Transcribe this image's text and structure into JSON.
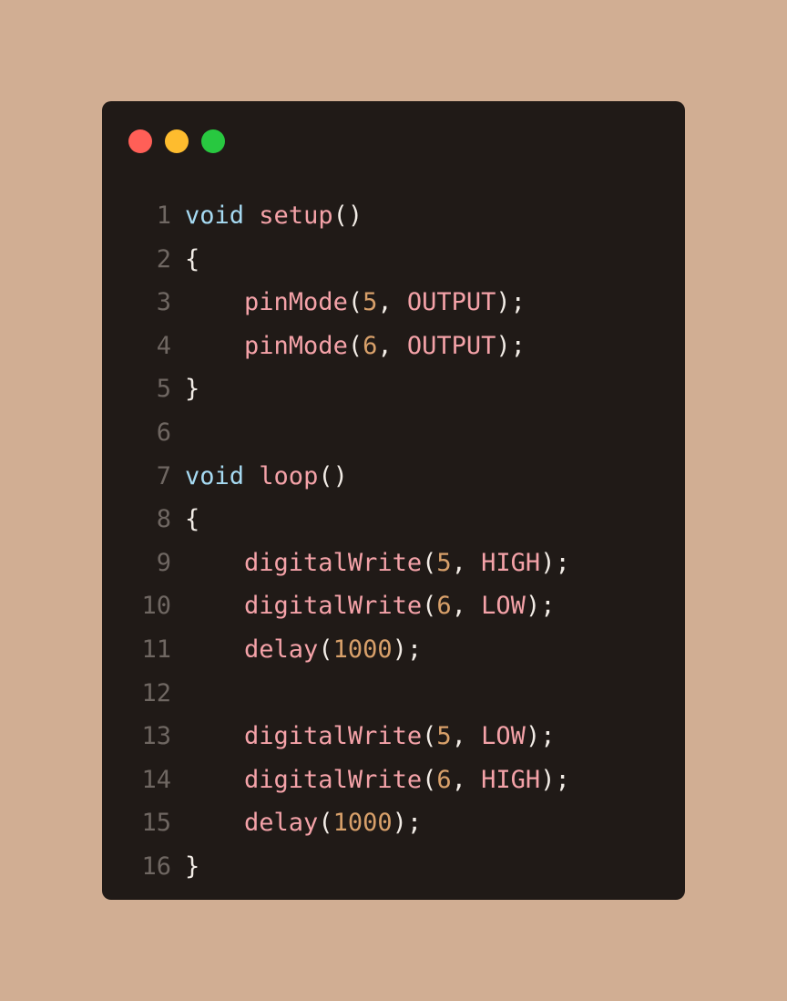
{
  "colors": {
    "page_background": "#d1ae93",
    "window_background": "#201a17",
    "line_number": "#6f6762",
    "keyword": "#a6daf2",
    "function": "#f4a2a8",
    "number": "#d8a06a",
    "constant": "#f4a2a8",
    "punctuation": "#f2ece6"
  },
  "window_controls": [
    {
      "name": "close",
      "color": "#ff5f57"
    },
    {
      "name": "minimize",
      "color": "#febc2e"
    },
    {
      "name": "maximize",
      "color": "#28c840"
    }
  ],
  "code": {
    "language": "arduino",
    "lines": [
      {
        "number": "1",
        "tokens": [
          {
            "t": "void",
            "k": "keyword"
          },
          {
            "t": " ",
            "k": "punctuation"
          },
          {
            "t": "setup",
            "k": "function"
          },
          {
            "t": "()",
            "k": "punctuation"
          }
        ]
      },
      {
        "number": "2",
        "tokens": [
          {
            "t": "{",
            "k": "punctuation"
          }
        ]
      },
      {
        "number": "3",
        "tokens": [
          {
            "t": "    ",
            "k": "punctuation"
          },
          {
            "t": "pinMode",
            "k": "function"
          },
          {
            "t": "(",
            "k": "punctuation"
          },
          {
            "t": "5",
            "k": "number"
          },
          {
            "t": ", ",
            "k": "punctuation"
          },
          {
            "t": "OUTPUT",
            "k": "constant"
          },
          {
            "t": ");",
            "k": "punctuation"
          }
        ]
      },
      {
        "number": "4",
        "tokens": [
          {
            "t": "    ",
            "k": "punctuation"
          },
          {
            "t": "pinMode",
            "k": "function"
          },
          {
            "t": "(",
            "k": "punctuation"
          },
          {
            "t": "6",
            "k": "number"
          },
          {
            "t": ", ",
            "k": "punctuation"
          },
          {
            "t": "OUTPUT",
            "k": "constant"
          },
          {
            "t": ");",
            "k": "punctuation"
          }
        ]
      },
      {
        "number": "5",
        "tokens": [
          {
            "t": "}",
            "k": "punctuation"
          }
        ]
      },
      {
        "number": "6",
        "tokens": []
      },
      {
        "number": "7",
        "tokens": [
          {
            "t": "void",
            "k": "keyword"
          },
          {
            "t": " ",
            "k": "punctuation"
          },
          {
            "t": "loop",
            "k": "function"
          },
          {
            "t": "()",
            "k": "punctuation"
          }
        ]
      },
      {
        "number": "8",
        "tokens": [
          {
            "t": "{",
            "k": "punctuation"
          }
        ]
      },
      {
        "number": "9",
        "tokens": [
          {
            "t": "    ",
            "k": "punctuation"
          },
          {
            "t": "digitalWrite",
            "k": "function"
          },
          {
            "t": "(",
            "k": "punctuation"
          },
          {
            "t": "5",
            "k": "number"
          },
          {
            "t": ", ",
            "k": "punctuation"
          },
          {
            "t": "HIGH",
            "k": "constant"
          },
          {
            "t": ");",
            "k": "punctuation"
          }
        ]
      },
      {
        "number": "10",
        "tokens": [
          {
            "t": "    ",
            "k": "punctuation"
          },
          {
            "t": "digitalWrite",
            "k": "function"
          },
          {
            "t": "(",
            "k": "punctuation"
          },
          {
            "t": "6",
            "k": "number"
          },
          {
            "t": ", ",
            "k": "punctuation"
          },
          {
            "t": "LOW",
            "k": "constant"
          },
          {
            "t": ");",
            "k": "punctuation"
          }
        ]
      },
      {
        "number": "11",
        "tokens": [
          {
            "t": "    ",
            "k": "punctuation"
          },
          {
            "t": "delay",
            "k": "function"
          },
          {
            "t": "(",
            "k": "punctuation"
          },
          {
            "t": "1000",
            "k": "number"
          },
          {
            "t": ");",
            "k": "punctuation"
          }
        ]
      },
      {
        "number": "12",
        "tokens": []
      },
      {
        "number": "13",
        "tokens": [
          {
            "t": "    ",
            "k": "punctuation"
          },
          {
            "t": "digitalWrite",
            "k": "function"
          },
          {
            "t": "(",
            "k": "punctuation"
          },
          {
            "t": "5",
            "k": "number"
          },
          {
            "t": ", ",
            "k": "punctuation"
          },
          {
            "t": "LOW",
            "k": "constant"
          },
          {
            "t": ");",
            "k": "punctuation"
          }
        ]
      },
      {
        "number": "14",
        "tokens": [
          {
            "t": "    ",
            "k": "punctuation"
          },
          {
            "t": "digitalWrite",
            "k": "function"
          },
          {
            "t": "(",
            "k": "punctuation"
          },
          {
            "t": "6",
            "k": "number"
          },
          {
            "t": ", ",
            "k": "punctuation"
          },
          {
            "t": "HIGH",
            "k": "constant"
          },
          {
            "t": ");",
            "k": "punctuation"
          }
        ]
      },
      {
        "number": "15",
        "tokens": [
          {
            "t": "    ",
            "k": "punctuation"
          },
          {
            "t": "delay",
            "k": "function"
          },
          {
            "t": "(",
            "k": "punctuation"
          },
          {
            "t": "1000",
            "k": "number"
          },
          {
            "t": ");",
            "k": "punctuation"
          }
        ]
      },
      {
        "number": "16",
        "tokens": [
          {
            "t": "}",
            "k": "punctuation"
          }
        ]
      }
    ]
  }
}
